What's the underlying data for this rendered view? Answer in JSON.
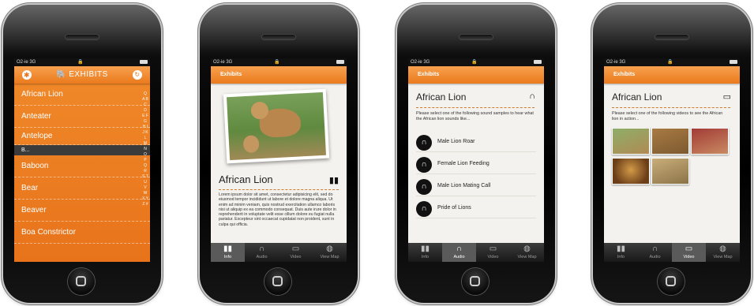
{
  "status": {
    "carrier": "O2-ie 3G",
    "lock": "🔒"
  },
  "tabs": [
    {
      "label": "Info",
      "icon": "map-icon",
      "glyph": "▮▮"
    },
    {
      "label": "Audio",
      "icon": "headphones-icon",
      "glyph": "∩"
    },
    {
      "label": "Video",
      "icon": "tv-icon",
      "glyph": "▭"
    },
    {
      "label": "View Map",
      "icon": "globe-icon",
      "glyph": "◍"
    }
  ],
  "screen1": {
    "title": "EXHIBITS",
    "items_top": [
      "African Lion",
      "Anteater",
      "Antelope"
    ],
    "section": "B...",
    "items_bottom": [
      "Baboon",
      "Bear",
      "Beaver",
      "Boa Constrictor"
    ],
    "index": "Q A B C D E F G H I J K L M N O P Q R S T U V W X Y Z #"
  },
  "screen2": {
    "nav_title": "Exhibits",
    "title": "African Lion",
    "body": "Lorem ipsum dolor sit amet, consectetur adipisicing elit, sed do eiusmod tempor incididunt ut labore et dolore magna aliqua. Ut enim ad minim veniam, quis nostrud exercitation ullamco laboris nisi ut aliquip ex ea commodo consequat. Duis aute irure dolor in reprehenderit in voluptate velit esse cillum dolore eu fugiat nulla pariatur. Excepteur sint occaecat cupidatat non proident, sunt in culpa qui officia."
  },
  "screen3": {
    "nav_title": "Exhibits",
    "title": "African Lion",
    "hint": "Please select one of the following sound samples to hear what the African lion sounds like...",
    "sounds": [
      "Male Lion Roar",
      "Female Lion Feeding",
      "Male Lion Mating Call",
      "Pride of Lions"
    ]
  },
  "screen4": {
    "nav_title": "Exhibits",
    "title": "African Lion",
    "hint": "Please select one of the following videos to see the African lion in action..."
  },
  "colors": {
    "accent": "#ea7a1d",
    "accent_light": "#f8a14f",
    "dark": "#111111"
  }
}
